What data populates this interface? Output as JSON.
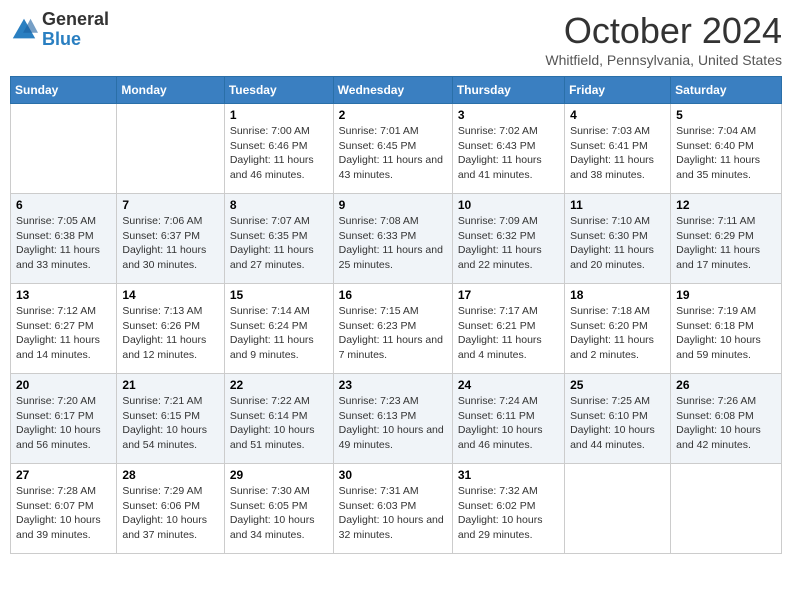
{
  "header": {
    "logo": {
      "general": "General",
      "blue": "Blue"
    },
    "title": "October 2024",
    "location": "Whitfield, Pennsylvania, United States"
  },
  "weekdays": [
    "Sunday",
    "Monday",
    "Tuesday",
    "Wednesday",
    "Thursday",
    "Friday",
    "Saturday"
  ],
  "weeks": [
    [
      {
        "day": "",
        "sunrise": "",
        "sunset": "",
        "daylight": ""
      },
      {
        "day": "",
        "sunrise": "",
        "sunset": "",
        "daylight": ""
      },
      {
        "day": "1",
        "sunrise": "Sunrise: 7:00 AM",
        "sunset": "Sunset: 6:46 PM",
        "daylight": "Daylight: 11 hours and 46 minutes."
      },
      {
        "day": "2",
        "sunrise": "Sunrise: 7:01 AM",
        "sunset": "Sunset: 6:45 PM",
        "daylight": "Daylight: 11 hours and 43 minutes."
      },
      {
        "day": "3",
        "sunrise": "Sunrise: 7:02 AM",
        "sunset": "Sunset: 6:43 PM",
        "daylight": "Daylight: 11 hours and 41 minutes."
      },
      {
        "day": "4",
        "sunrise": "Sunrise: 7:03 AM",
        "sunset": "Sunset: 6:41 PM",
        "daylight": "Daylight: 11 hours and 38 minutes."
      },
      {
        "day": "5",
        "sunrise": "Sunrise: 7:04 AM",
        "sunset": "Sunset: 6:40 PM",
        "daylight": "Daylight: 11 hours and 35 minutes."
      }
    ],
    [
      {
        "day": "6",
        "sunrise": "Sunrise: 7:05 AM",
        "sunset": "Sunset: 6:38 PM",
        "daylight": "Daylight: 11 hours and 33 minutes."
      },
      {
        "day": "7",
        "sunrise": "Sunrise: 7:06 AM",
        "sunset": "Sunset: 6:37 PM",
        "daylight": "Daylight: 11 hours and 30 minutes."
      },
      {
        "day": "8",
        "sunrise": "Sunrise: 7:07 AM",
        "sunset": "Sunset: 6:35 PM",
        "daylight": "Daylight: 11 hours and 27 minutes."
      },
      {
        "day": "9",
        "sunrise": "Sunrise: 7:08 AM",
        "sunset": "Sunset: 6:33 PM",
        "daylight": "Daylight: 11 hours and 25 minutes."
      },
      {
        "day": "10",
        "sunrise": "Sunrise: 7:09 AM",
        "sunset": "Sunset: 6:32 PM",
        "daylight": "Daylight: 11 hours and 22 minutes."
      },
      {
        "day": "11",
        "sunrise": "Sunrise: 7:10 AM",
        "sunset": "Sunset: 6:30 PM",
        "daylight": "Daylight: 11 hours and 20 minutes."
      },
      {
        "day": "12",
        "sunrise": "Sunrise: 7:11 AM",
        "sunset": "Sunset: 6:29 PM",
        "daylight": "Daylight: 11 hours and 17 minutes."
      }
    ],
    [
      {
        "day": "13",
        "sunrise": "Sunrise: 7:12 AM",
        "sunset": "Sunset: 6:27 PM",
        "daylight": "Daylight: 11 hours and 14 minutes."
      },
      {
        "day": "14",
        "sunrise": "Sunrise: 7:13 AM",
        "sunset": "Sunset: 6:26 PM",
        "daylight": "Daylight: 11 hours and 12 minutes."
      },
      {
        "day": "15",
        "sunrise": "Sunrise: 7:14 AM",
        "sunset": "Sunset: 6:24 PM",
        "daylight": "Daylight: 11 hours and 9 minutes."
      },
      {
        "day": "16",
        "sunrise": "Sunrise: 7:15 AM",
        "sunset": "Sunset: 6:23 PM",
        "daylight": "Daylight: 11 hours and 7 minutes."
      },
      {
        "day": "17",
        "sunrise": "Sunrise: 7:17 AM",
        "sunset": "Sunset: 6:21 PM",
        "daylight": "Daylight: 11 hours and 4 minutes."
      },
      {
        "day": "18",
        "sunrise": "Sunrise: 7:18 AM",
        "sunset": "Sunset: 6:20 PM",
        "daylight": "Daylight: 11 hours and 2 minutes."
      },
      {
        "day": "19",
        "sunrise": "Sunrise: 7:19 AM",
        "sunset": "Sunset: 6:18 PM",
        "daylight": "Daylight: 10 hours and 59 minutes."
      }
    ],
    [
      {
        "day": "20",
        "sunrise": "Sunrise: 7:20 AM",
        "sunset": "Sunset: 6:17 PM",
        "daylight": "Daylight: 10 hours and 56 minutes."
      },
      {
        "day": "21",
        "sunrise": "Sunrise: 7:21 AM",
        "sunset": "Sunset: 6:15 PM",
        "daylight": "Daylight: 10 hours and 54 minutes."
      },
      {
        "day": "22",
        "sunrise": "Sunrise: 7:22 AM",
        "sunset": "Sunset: 6:14 PM",
        "daylight": "Daylight: 10 hours and 51 minutes."
      },
      {
        "day": "23",
        "sunrise": "Sunrise: 7:23 AM",
        "sunset": "Sunset: 6:13 PM",
        "daylight": "Daylight: 10 hours and 49 minutes."
      },
      {
        "day": "24",
        "sunrise": "Sunrise: 7:24 AM",
        "sunset": "Sunset: 6:11 PM",
        "daylight": "Daylight: 10 hours and 46 minutes."
      },
      {
        "day": "25",
        "sunrise": "Sunrise: 7:25 AM",
        "sunset": "Sunset: 6:10 PM",
        "daylight": "Daylight: 10 hours and 44 minutes."
      },
      {
        "day": "26",
        "sunrise": "Sunrise: 7:26 AM",
        "sunset": "Sunset: 6:08 PM",
        "daylight": "Daylight: 10 hours and 42 minutes."
      }
    ],
    [
      {
        "day": "27",
        "sunrise": "Sunrise: 7:28 AM",
        "sunset": "Sunset: 6:07 PM",
        "daylight": "Daylight: 10 hours and 39 minutes."
      },
      {
        "day": "28",
        "sunrise": "Sunrise: 7:29 AM",
        "sunset": "Sunset: 6:06 PM",
        "daylight": "Daylight: 10 hours and 37 minutes."
      },
      {
        "day": "29",
        "sunrise": "Sunrise: 7:30 AM",
        "sunset": "Sunset: 6:05 PM",
        "daylight": "Daylight: 10 hours and 34 minutes."
      },
      {
        "day": "30",
        "sunrise": "Sunrise: 7:31 AM",
        "sunset": "Sunset: 6:03 PM",
        "daylight": "Daylight: 10 hours and 32 minutes."
      },
      {
        "day": "31",
        "sunrise": "Sunrise: 7:32 AM",
        "sunset": "Sunset: 6:02 PM",
        "daylight": "Daylight: 10 hours and 29 minutes."
      },
      {
        "day": "",
        "sunrise": "",
        "sunset": "",
        "daylight": ""
      },
      {
        "day": "",
        "sunrise": "",
        "sunset": "",
        "daylight": ""
      }
    ]
  ]
}
